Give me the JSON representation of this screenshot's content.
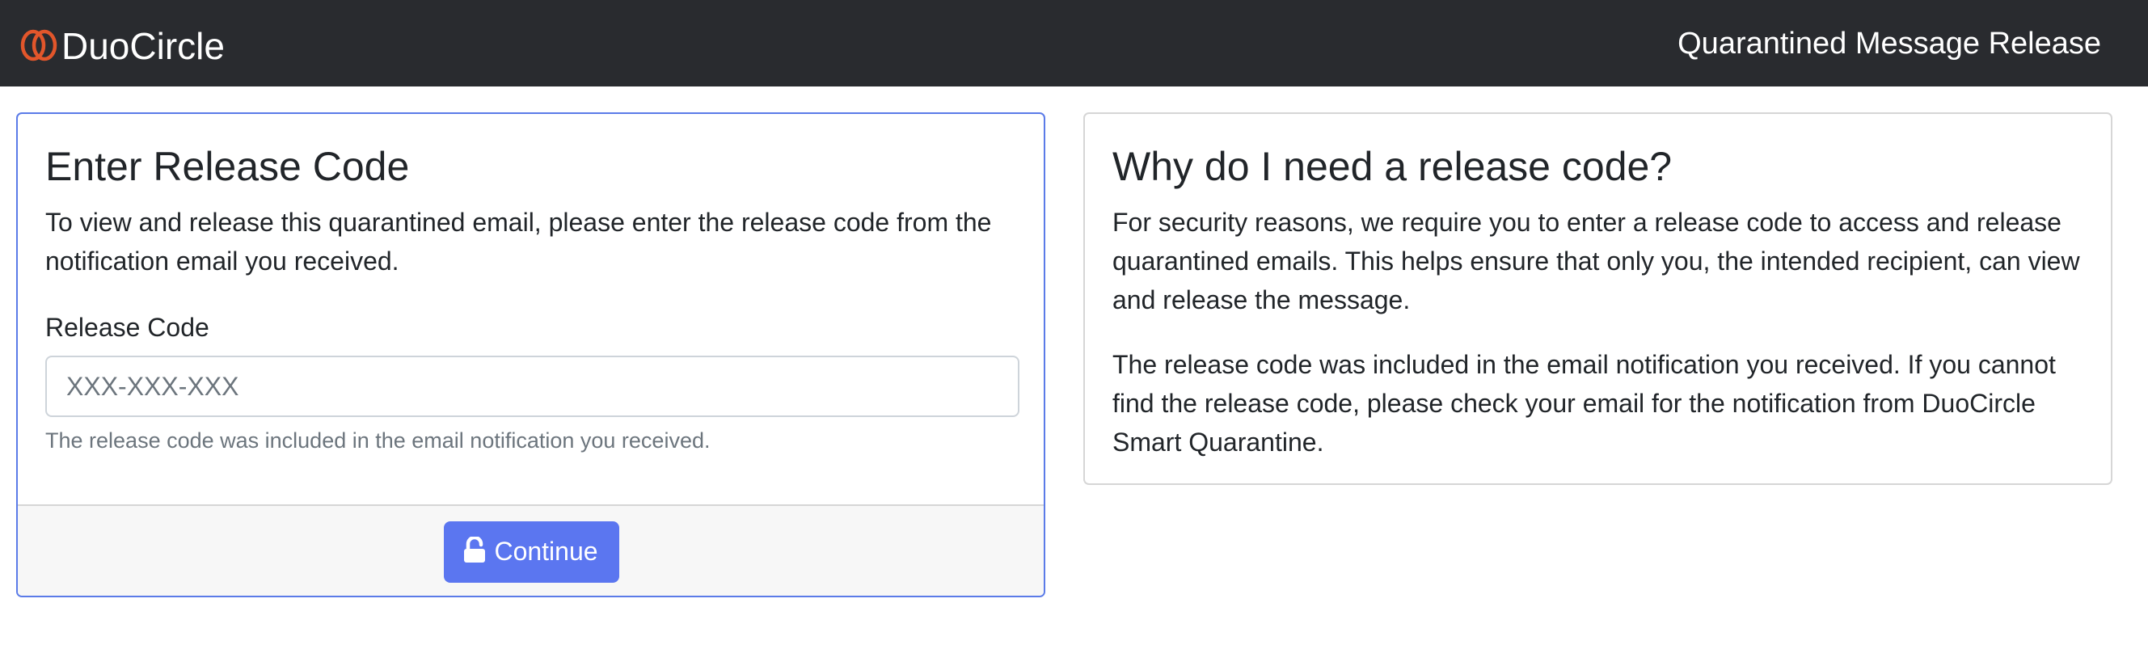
{
  "header": {
    "brand": "DuoCircle",
    "logo_icon": "duocircle-rings-logo",
    "title": "Quarantined Message Release"
  },
  "release_form": {
    "title": "Enter Release Code",
    "description": "To view and release this quarantined email, please enter the release code from the notification email you received.",
    "field_label": "Release Code",
    "placeholder": "XXX-XXX-XXX",
    "value": "",
    "help_text": "The release code was included in the email notification you received.",
    "button_label": "Continue",
    "button_icon": "unlock-icon"
  },
  "info": {
    "title": "Why do I need a release code?",
    "paragraphs": [
      "For security reasons, we require you to enter a release code to access and release quarantined emails. This helps ensure that only you, the intended recipient, can view and release the message.",
      "The release code was included in the email notification you received. If you cannot find the release code, please check your email for the notification from DuoCircle Smart Quarantine."
    ]
  },
  "colors": {
    "header_bg": "#292b2f",
    "logo_orange": "#e2562b",
    "active_border": "#5b7be8",
    "button_bg": "#5b76f0",
    "footer_bg": "#f7f7f7"
  }
}
